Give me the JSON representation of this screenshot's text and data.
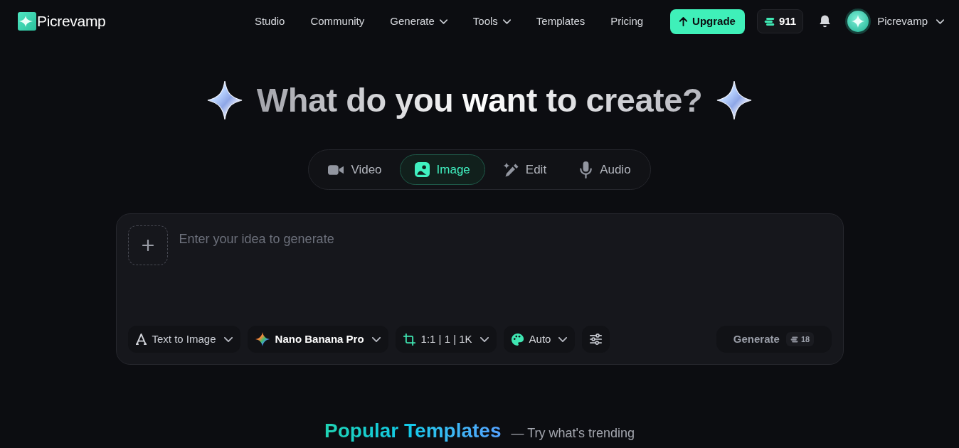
{
  "header": {
    "brand": "Picrevamp",
    "nav": [
      {
        "label": "Studio",
        "has_menu": false
      },
      {
        "label": "Community",
        "has_menu": false
      },
      {
        "label": "Generate",
        "has_menu": true
      },
      {
        "label": "Tools",
        "has_menu": true
      },
      {
        "label": "Templates",
        "has_menu": false
      },
      {
        "label": "Pricing",
        "has_menu": false
      }
    ],
    "upgrade_button": "Upgrade",
    "credits": "911",
    "user_name": "Picrevamp"
  },
  "hero": {
    "title": "What do you want to create?"
  },
  "mode_tabs": [
    {
      "kind": "video",
      "label": "Video",
      "selected": false
    },
    {
      "kind": "image",
      "label": "Image",
      "selected": true
    },
    {
      "kind": "edit",
      "label": "Edit",
      "selected": false
    },
    {
      "kind": "audio",
      "label": "Audio",
      "selected": false
    }
  ],
  "prompt": {
    "placeholder": "Enter your idea to generate",
    "options": [
      {
        "kind": "mode",
        "label": "Text to Image"
      },
      {
        "kind": "model",
        "label": "Nano Banana Pro"
      },
      {
        "kind": "ratio",
        "label": "1:1 | 1 | 1K"
      },
      {
        "kind": "style",
        "label": "Auto"
      },
      {
        "kind": "settings"
      }
    ],
    "generate": {
      "label": "Generate",
      "cost": "18",
      "disabled": true
    }
  },
  "templates": {
    "title": "Popular Templates",
    "subtitle": "— Try what's trending"
  }
}
